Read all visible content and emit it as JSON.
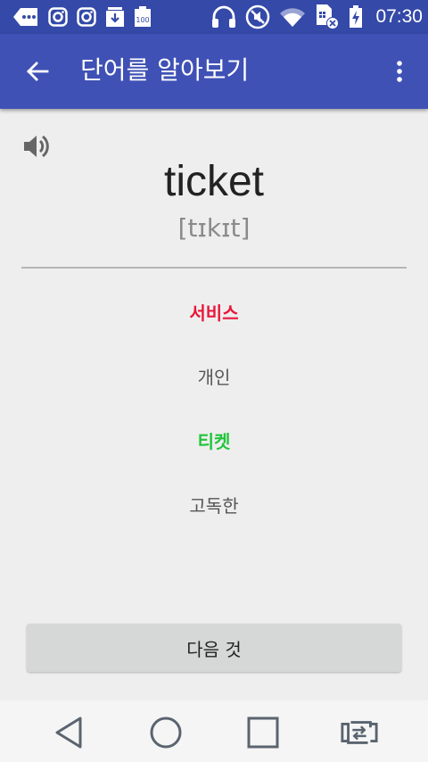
{
  "status_bar": {
    "time": "07:30",
    "battery_text": "100",
    "icons": [
      "more-icon",
      "instagram-icon",
      "instagram-icon",
      "download-icon",
      "battery-100-icon",
      "headphones-icon",
      "mute-icon",
      "wifi-icon",
      "sim-off-icon",
      "battery-charging-icon"
    ]
  },
  "app_bar": {
    "title": "단어를 알아보기",
    "back_icon": "arrow-back-icon",
    "menu_icon": "more-vert-icon"
  },
  "word_card": {
    "speaker_icon": "speaker-icon",
    "word": "ticket",
    "phonetic": "[tɪkɪt]"
  },
  "options": [
    {
      "label": "서비스",
      "color": "#e8173a"
    },
    {
      "label": "개인",
      "color": "#555555"
    },
    {
      "label": "티켓",
      "color": "#21c43b"
    },
    {
      "label": "고독한",
      "color": "#555555"
    }
  ],
  "next_button": {
    "label": "다음 것"
  },
  "nav_bar": {
    "icons": [
      "back-triangle-icon",
      "home-circle-icon",
      "recents-square-icon",
      "screen-switch-icon"
    ]
  },
  "colors": {
    "status_bar": "#3449a8",
    "app_bar": "#3f51b5",
    "background": "#eeeeee"
  }
}
